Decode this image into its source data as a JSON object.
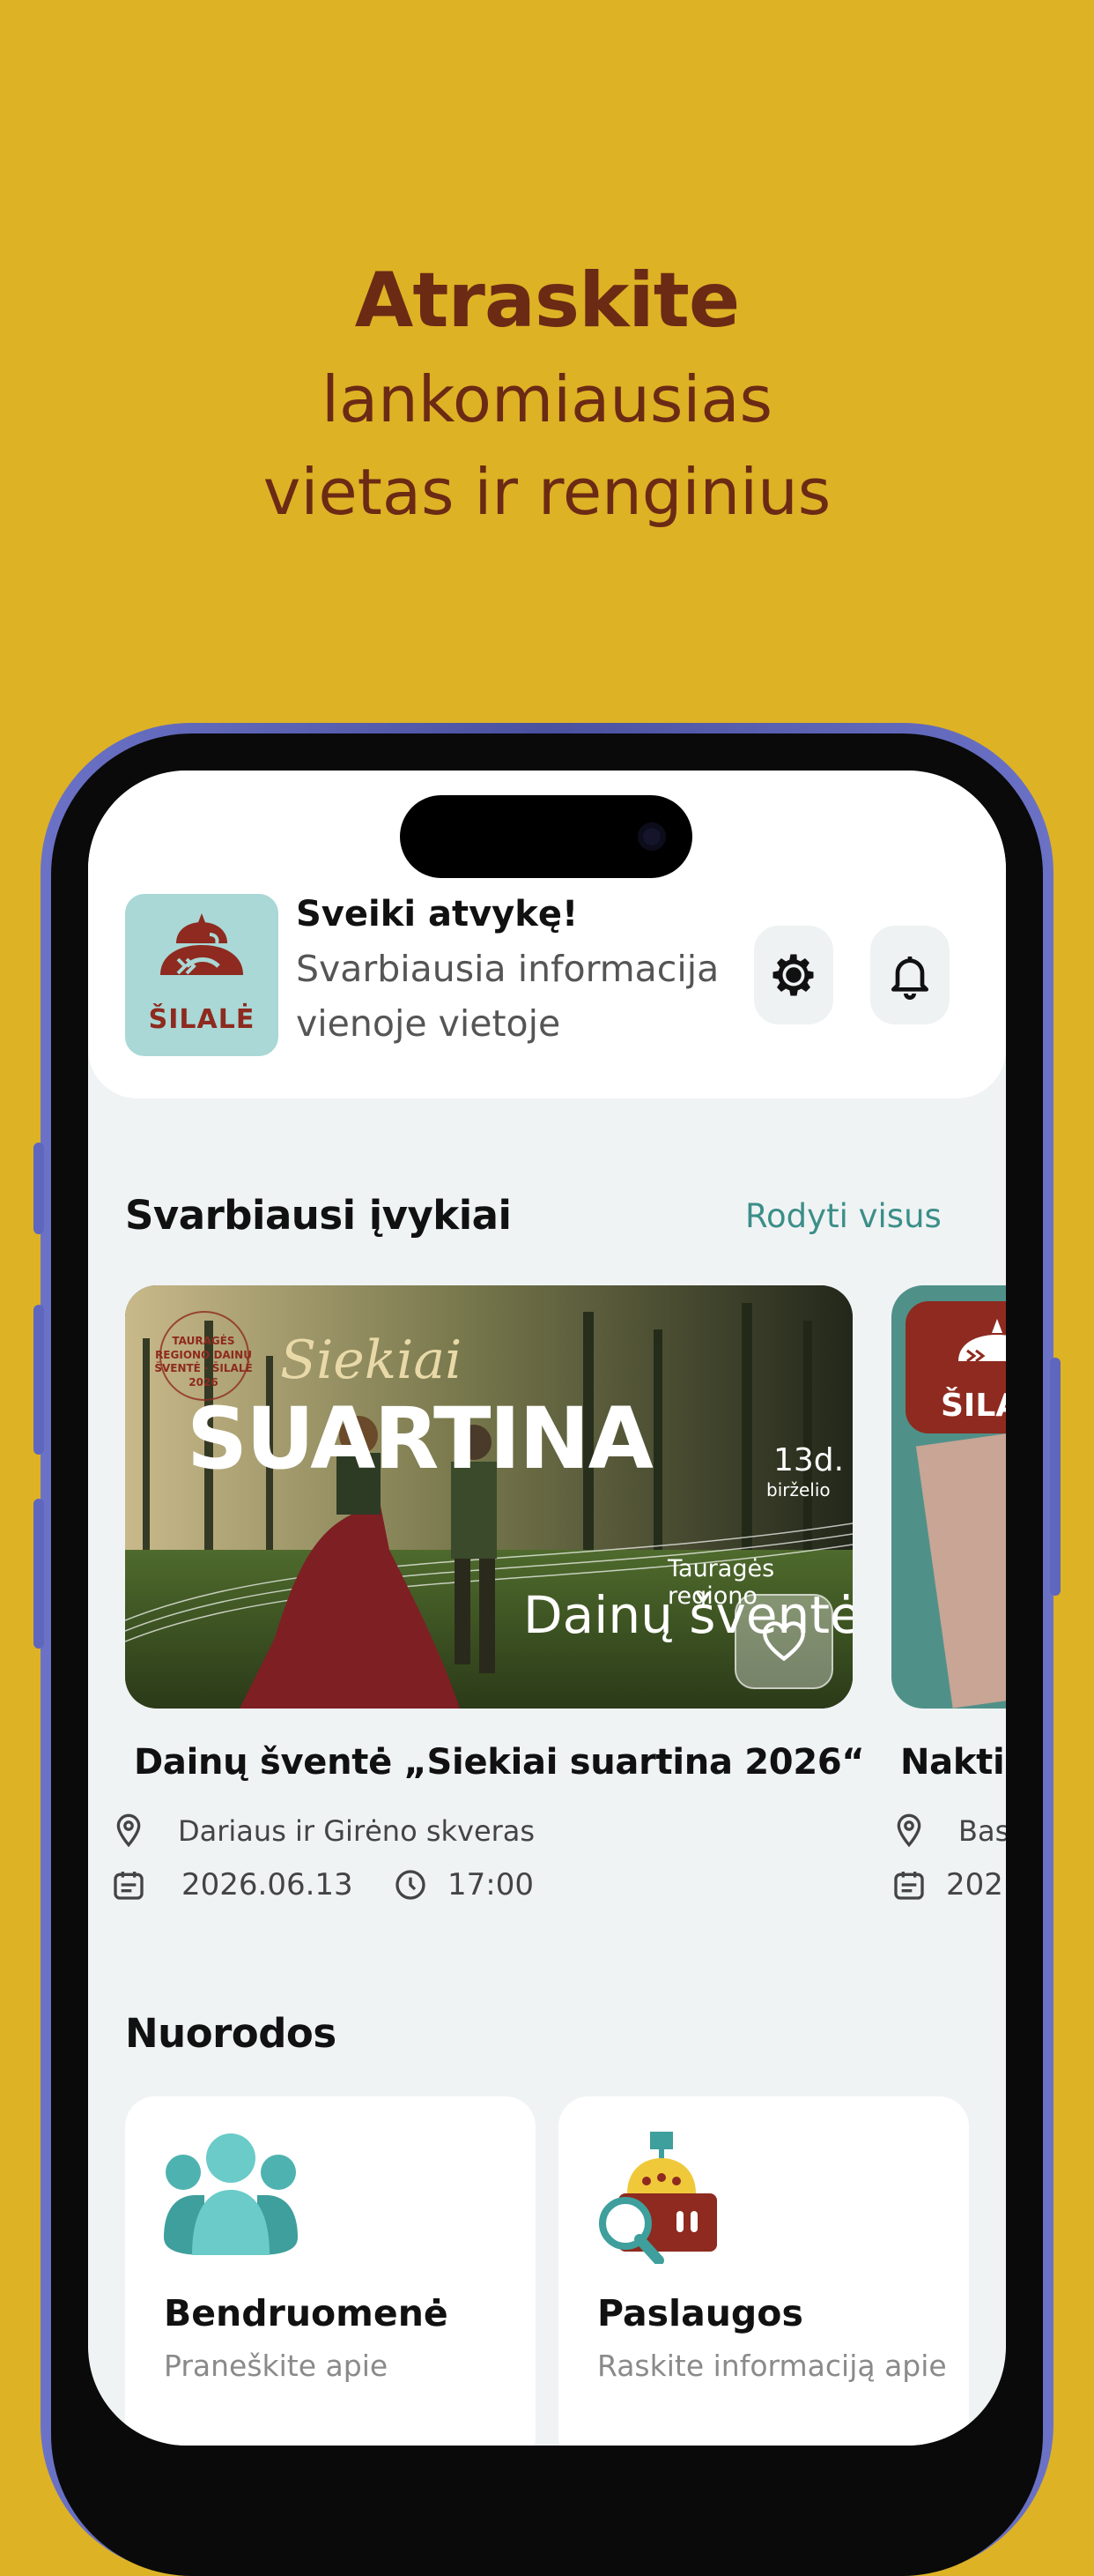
{
  "promo": {
    "title": "Atraskite",
    "line1": "lankomiausias",
    "line2": "vietas ir renginius"
  },
  "header": {
    "logo_text": "ŠILALĖ",
    "greeting": "Sveiki atvykę!",
    "subtitle": "Svarbiausia informacija vienoje vietoje"
  },
  "events_section": {
    "title": "Svarbiausi įvykiai",
    "show_all": "Rodyti visus",
    "featured": {
      "poster": {
        "badge": "TAURAGĖS REGIONO DAINŲ ŠVENTĖ · ŠILALĖ 2026",
        "script": "Siekiai",
        "big": "SUARTINA",
        "day": "13d.",
        "month": "birželio",
        "region": "Tauragės regiono",
        "festival": "Dainų šventė"
      },
      "title": "Dainų šventė „Siekiai suartina 2026“",
      "location": "Dariaus ir Girėno skveras",
      "date": "2026.06.13",
      "time": "17:00"
    },
    "next": {
      "poster_text": "ŠILA",
      "title": "Naktis",
      "location": "Basa",
      "date": "202"
    }
  },
  "links_section": {
    "title": "Nuorodos",
    "tiles": [
      {
        "name": "Bendruomenė",
        "desc": "Praneškite apie"
      },
      {
        "name": "Paslaugos",
        "desc": "Raskite informaciją apie"
      }
    ]
  },
  "colors": {
    "background": "#DDB225",
    "headline": "#6B2A14",
    "accent": "#3C8E88",
    "frame": "#5E66BE"
  },
  "icons": [
    "gear-icon",
    "bell-icon",
    "heart-icon",
    "location-pin-icon",
    "calendar-icon",
    "clock-icon",
    "community-icon",
    "services-icon"
  ]
}
